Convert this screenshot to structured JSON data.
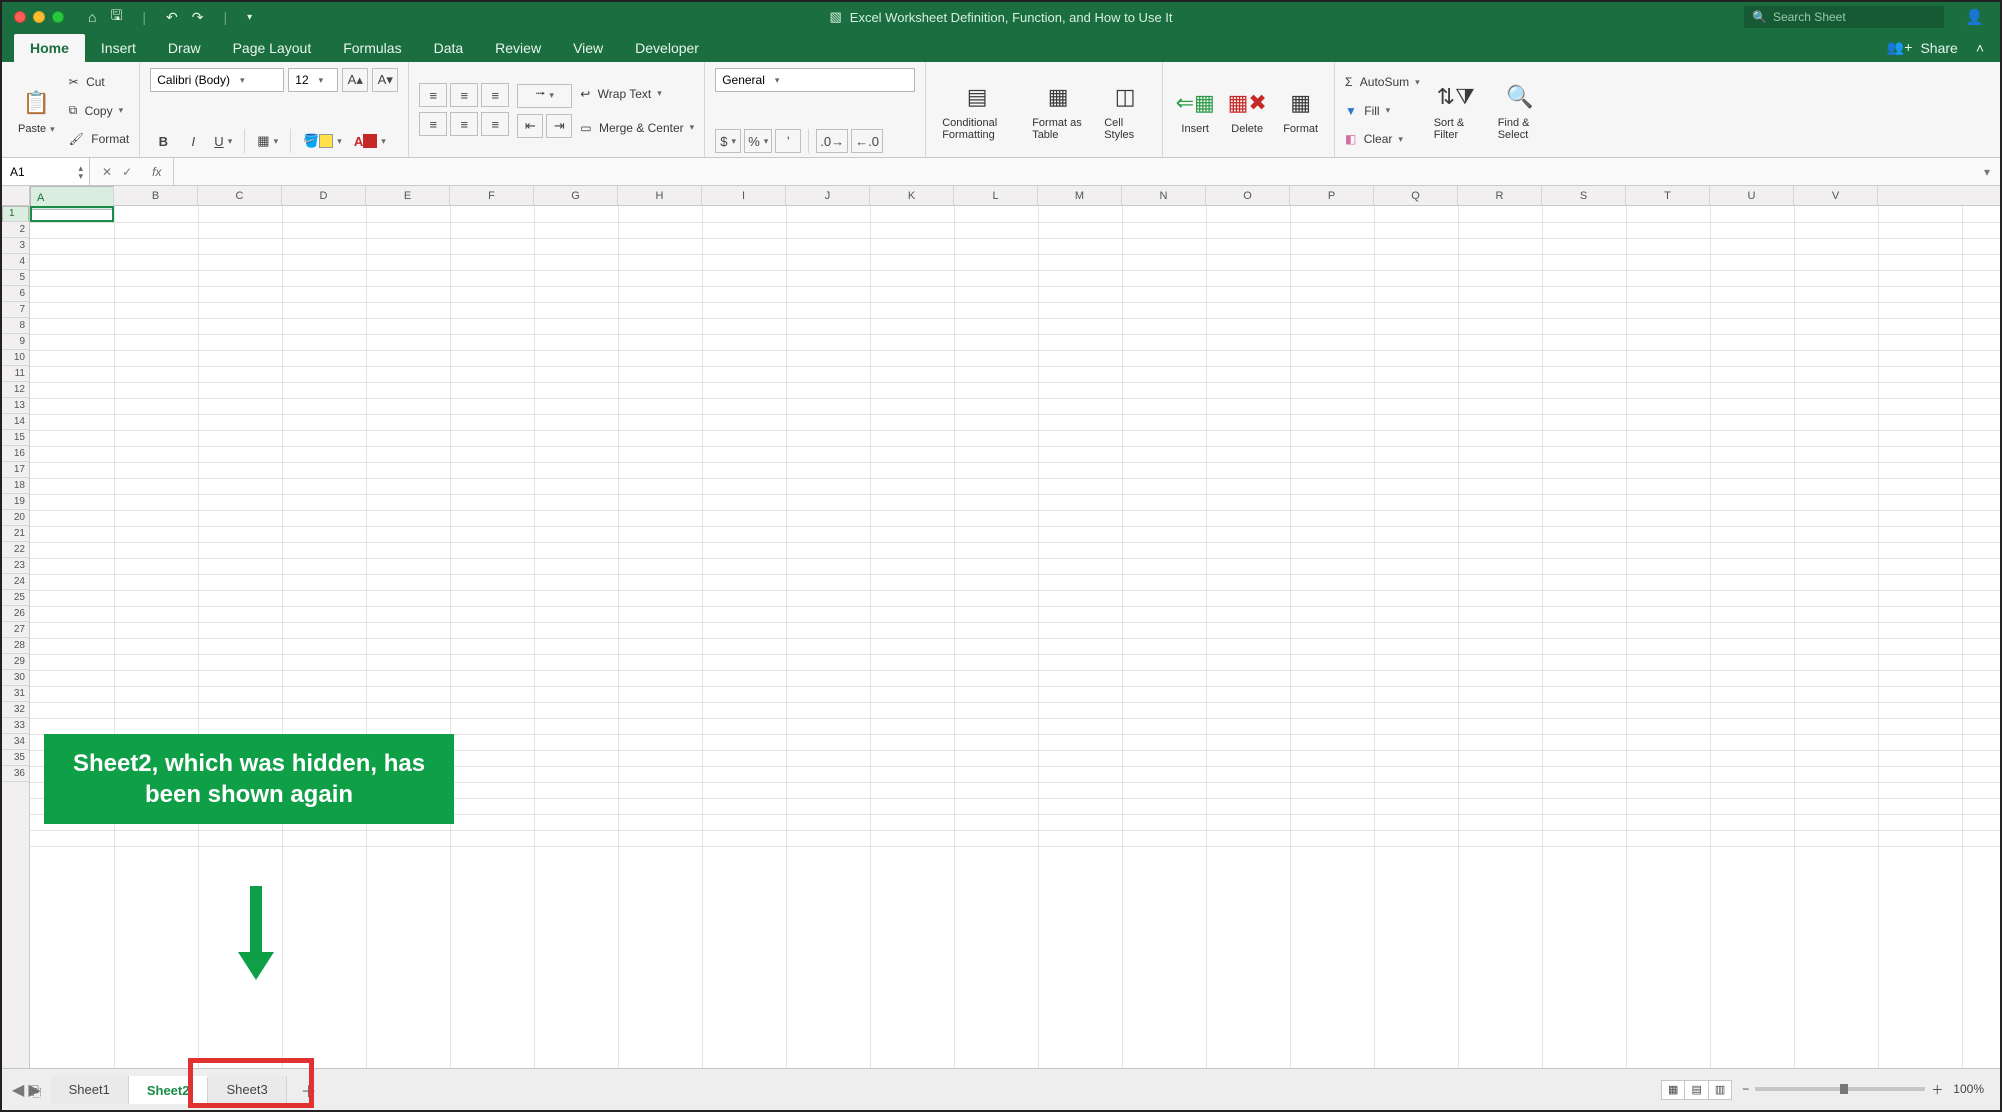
{
  "titlebar": {
    "doc_title": "Excel Worksheet Definition, Function, and How to Use It",
    "search_placeholder": "Search Sheet"
  },
  "tabs": [
    "Home",
    "Insert",
    "Draw",
    "Page Layout",
    "Formulas",
    "Data",
    "Review",
    "View",
    "Developer"
  ],
  "active_tab": "Home",
  "share_label": "Share",
  "clipboard": {
    "paste": "Paste",
    "cut": "Cut",
    "copy": "Copy",
    "format": "Format"
  },
  "font": {
    "name": "Calibri (Body)",
    "size": "12"
  },
  "alignment": {
    "wrap": "Wrap Text",
    "merge": "Merge & Center"
  },
  "number": {
    "format": "General"
  },
  "styles": {
    "cond": "Conditional Formatting",
    "fat": "Format as Table",
    "cell": "Cell Styles"
  },
  "cells": {
    "insert": "Insert",
    "delete": "Delete",
    "format": "Format"
  },
  "editing": {
    "autosum": "AutoSum",
    "fill": "Fill",
    "clear": "Clear",
    "sort": "Sort & Filter",
    "find": "Find & Select"
  },
  "formula_bar": {
    "name": "A1",
    "fx": "fx"
  },
  "columns": [
    "A",
    "B",
    "C",
    "D",
    "E",
    "F",
    "G",
    "H",
    "I",
    "J",
    "K",
    "L",
    "M",
    "N",
    "O",
    "P",
    "Q",
    "R",
    "S",
    "T",
    "U",
    "V"
  ],
  "rows": [
    "1",
    "2",
    "3",
    "4",
    "5",
    "6",
    "7",
    "8",
    "9",
    "10",
    "11",
    "12",
    "13",
    "14",
    "15",
    "16",
    "17",
    "18",
    "19",
    "20",
    "21",
    "22",
    "23",
    "24",
    "25",
    "26",
    "27",
    "28",
    "29",
    "30",
    "31",
    "32",
    "33",
    "34",
    "35",
    "36"
  ],
  "selected_cell": "A1",
  "callout_text": "Sheet2, which was hidden, has been shown again",
  "sheets": [
    "Sheet1",
    "Sheet2",
    "Sheet3"
  ],
  "active_sheet": "Sheet2",
  "zoom": "100%"
}
